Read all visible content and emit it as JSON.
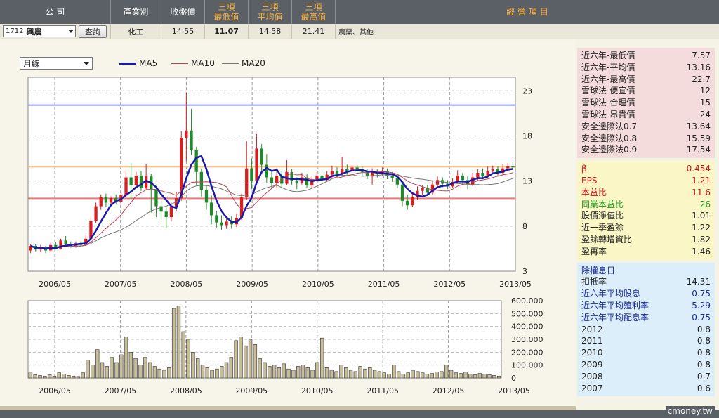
{
  "header": {
    "company": "公  司",
    "industry": "產業別",
    "close": "收盤價",
    "low_1": "三項",
    "low_2": "最低值",
    "avg_1": "三項",
    "avg_2": "平均值",
    "high_1": "三項",
    "high_2": "最高值",
    "business": "經 營 項 目"
  },
  "row": {
    "stock_code": "1712",
    "stock_name": "興農",
    "query_button": "查詢",
    "industry": "化工",
    "close": "14.55",
    "low": "11.07",
    "avg": "14.58",
    "high": "21.41",
    "business": "農藥、其他"
  },
  "chart_controls": {
    "period": "月線",
    "ma5": "MA5",
    "ma10": "MA10",
    "ma20": "MA20"
  },
  "colors": {
    "ma5": "#1a1aa8",
    "ma10": "#c04050",
    "ma20": "#777777",
    "up": "#d62020",
    "down": "#1f8a2a",
    "line_high": "#8a90ff",
    "line_avg": "#ffc080",
    "line_low": "#ff7070",
    "volume_bar": "#c7bd9a"
  },
  "chart_data": [
    {
      "type": "candlestick",
      "x_labels": [
        "2006/05",
        "2007/05",
        "2008/05",
        "2009/05",
        "2010/05",
        "2011/05",
        "2012/05",
        "2013/05"
      ],
      "y_ticks": [
        23,
        18,
        13,
        8,
        3
      ],
      "ylim": [
        3,
        24.5
      ],
      "reference_lines": {
        "high": 21.41,
        "avg": 14.58,
        "low": 11.07
      },
      "candles": [
        {
          "o": 5.3,
          "c": 5.8,
          "h": 6.0,
          "l": 5.0
        },
        {
          "o": 5.8,
          "c": 5.4,
          "h": 6.0,
          "l": 5.2
        },
        {
          "o": 5.4,
          "c": 5.6,
          "h": 5.9,
          "l": 5.1
        },
        {
          "o": 5.6,
          "c": 5.3,
          "h": 5.8,
          "l": 5.0
        },
        {
          "o": 5.3,
          "c": 5.9,
          "h": 6.1,
          "l": 5.2
        },
        {
          "o": 5.9,
          "c": 5.5,
          "h": 6.2,
          "l": 5.4
        },
        {
          "o": 5.5,
          "c": 6.4,
          "h": 6.6,
          "l": 5.4
        },
        {
          "o": 6.4,
          "c": 6.0,
          "h": 6.9,
          "l": 5.8
        },
        {
          "o": 6.0,
          "c": 5.8,
          "h": 6.3,
          "l": 5.6
        },
        {
          "o": 5.8,
          "c": 6.1,
          "h": 6.3,
          "l": 5.6
        },
        {
          "o": 6.1,
          "c": 5.9,
          "h": 6.3,
          "l": 5.7
        },
        {
          "o": 5.9,
          "c": 6.6,
          "h": 7.0,
          "l": 5.8
        },
        {
          "o": 6.6,
          "c": 8.6,
          "h": 8.9,
          "l": 6.5
        },
        {
          "o": 8.6,
          "c": 10.2,
          "h": 10.6,
          "l": 8.3
        },
        {
          "o": 10.2,
          "c": 11.2,
          "h": 11.5,
          "l": 9.8
        },
        {
          "o": 11.2,
          "c": 10.6,
          "h": 11.6,
          "l": 10.1
        },
        {
          "o": 10.6,
          "c": 11.1,
          "h": 11.3,
          "l": 10.3
        },
        {
          "o": 11.1,
          "c": 10.7,
          "h": 11.5,
          "l": 10.5
        },
        {
          "o": 10.7,
          "c": 11.4,
          "h": 11.7,
          "l": 10.5
        },
        {
          "o": 11.4,
          "c": 13.4,
          "h": 14.2,
          "l": 11.2
        },
        {
          "o": 13.4,
          "c": 12.5,
          "h": 15.0,
          "l": 11.0
        },
        {
          "o": 12.5,
          "c": 13.6,
          "h": 14.0,
          "l": 12.2
        },
        {
          "o": 13.6,
          "c": 12.2,
          "h": 14.1,
          "l": 11.9
        },
        {
          "o": 12.2,
          "c": 13.5,
          "h": 14.9,
          "l": 12.0
        },
        {
          "o": 13.5,
          "c": 12.1,
          "h": 13.8,
          "l": 9.5
        },
        {
          "o": 12.1,
          "c": 10.2,
          "h": 12.3,
          "l": 9.0
        },
        {
          "o": 10.2,
          "c": 9.6,
          "h": 10.8,
          "l": 8.7
        },
        {
          "o": 9.6,
          "c": 9.0,
          "h": 10.0,
          "l": 7.8
        },
        {
          "o": 9.0,
          "c": 10.1,
          "h": 10.6,
          "l": 8.5
        },
        {
          "o": 10.1,
          "c": 11.1,
          "h": 11.8,
          "l": 9.7
        },
        {
          "o": 11.1,
          "c": 17.8,
          "h": 18.5,
          "l": 10.8
        },
        {
          "o": 17.8,
          "c": 18.6,
          "h": 22.8,
          "l": 15.2
        },
        {
          "o": 18.6,
          "c": 16.4,
          "h": 21.0,
          "l": 15.9
        },
        {
          "o": 16.4,
          "c": 14.0,
          "h": 16.8,
          "l": 12.6
        },
        {
          "o": 14.0,
          "c": 12.0,
          "h": 14.4,
          "l": 11.3
        },
        {
          "o": 12.0,
          "c": 10.6,
          "h": 12.5,
          "l": 9.8
        },
        {
          "o": 10.6,
          "c": 9.2,
          "h": 11.4,
          "l": 8.2
        },
        {
          "o": 9.2,
          "c": 8.4,
          "h": 9.7,
          "l": 7.8
        },
        {
          "o": 8.4,
          "c": 8.1,
          "h": 9.2,
          "l": 7.6
        },
        {
          "o": 8.1,
          "c": 8.5,
          "h": 9.0,
          "l": 7.7
        },
        {
          "o": 8.5,
          "c": 8.2,
          "h": 9.1,
          "l": 7.7
        },
        {
          "o": 8.2,
          "c": 8.9,
          "h": 9.4,
          "l": 7.9
        },
        {
          "o": 8.9,
          "c": 11.2,
          "h": 11.6,
          "l": 8.7
        },
        {
          "o": 11.2,
          "c": 14.4,
          "h": 17.4,
          "l": 10.9
        },
        {
          "o": 14.4,
          "c": 13.0,
          "h": 15.5,
          "l": 12.1
        },
        {
          "o": 13.0,
          "c": 16.6,
          "h": 18.2,
          "l": 12.6
        },
        {
          "o": 16.6,
          "c": 14.8,
          "h": 17.1,
          "l": 13.8
        },
        {
          "o": 14.8,
          "c": 13.4,
          "h": 16.0,
          "l": 12.8
        },
        {
          "o": 13.4,
          "c": 12.8,
          "h": 14.0,
          "l": 12.3
        },
        {
          "o": 12.8,
          "c": 13.6,
          "h": 14.4,
          "l": 12.2
        },
        {
          "o": 13.6,
          "c": 12.7,
          "h": 14.1,
          "l": 12.3
        },
        {
          "o": 12.7,
          "c": 14.0,
          "h": 15.3,
          "l": 12.5
        },
        {
          "o": 14.0,
          "c": 13.0,
          "h": 14.3,
          "l": 12.6
        },
        {
          "o": 13.0,
          "c": 12.8,
          "h": 13.4,
          "l": 12.1
        },
        {
          "o": 12.8,
          "c": 13.4,
          "h": 13.9,
          "l": 12.6
        },
        {
          "o": 13.4,
          "c": 12.5,
          "h": 13.8,
          "l": 12.2
        },
        {
          "o": 12.5,
          "c": 13.2,
          "h": 13.6,
          "l": 12.2
        },
        {
          "o": 13.2,
          "c": 13.6,
          "h": 14.0,
          "l": 12.9
        },
        {
          "o": 13.6,
          "c": 13.1,
          "h": 14.0,
          "l": 12.8
        },
        {
          "o": 13.1,
          "c": 13.7,
          "h": 14.1,
          "l": 12.9
        },
        {
          "o": 13.7,
          "c": 14.1,
          "h": 14.7,
          "l": 13.5
        },
        {
          "o": 14.1,
          "c": 13.8,
          "h": 14.5,
          "l": 13.3
        },
        {
          "o": 13.8,
          "c": 14.3,
          "h": 15.7,
          "l": 13.6
        },
        {
          "o": 14.3,
          "c": 14.1,
          "h": 14.8,
          "l": 13.7
        },
        {
          "o": 14.1,
          "c": 14.5,
          "h": 14.9,
          "l": 13.9
        },
        {
          "o": 14.5,
          "c": 14.2,
          "h": 14.8,
          "l": 13.8
        },
        {
          "o": 14.2,
          "c": 14.0,
          "h": 14.6,
          "l": 13.6
        },
        {
          "o": 14.0,
          "c": 13.5,
          "h": 14.3,
          "l": 13.2
        },
        {
          "o": 13.5,
          "c": 14.0,
          "h": 14.4,
          "l": 12.6
        },
        {
          "o": 14.0,
          "c": 13.8,
          "h": 14.3,
          "l": 13.4
        },
        {
          "o": 13.8,
          "c": 14.1,
          "h": 14.5,
          "l": 13.6
        },
        {
          "o": 14.1,
          "c": 13.6,
          "h": 14.4,
          "l": 13.2
        },
        {
          "o": 13.6,
          "c": 13.3,
          "h": 14.0,
          "l": 12.9
        },
        {
          "o": 13.3,
          "c": 12.6,
          "h": 13.6,
          "l": 12.2
        },
        {
          "o": 12.6,
          "c": 10.8,
          "h": 12.9,
          "l": 10.2
        },
        {
          "o": 10.8,
          "c": 10.3,
          "h": 11.5,
          "l": 9.8
        },
        {
          "o": 10.3,
          "c": 11.2,
          "h": 11.7,
          "l": 10.1
        },
        {
          "o": 11.2,
          "c": 11.9,
          "h": 12.4,
          "l": 10.9
        },
        {
          "o": 11.9,
          "c": 12.2,
          "h": 12.5,
          "l": 11.5
        },
        {
          "o": 12.2,
          "c": 11.7,
          "h": 12.6,
          "l": 11.4
        },
        {
          "o": 11.7,
          "c": 12.6,
          "h": 13.0,
          "l": 11.5
        },
        {
          "o": 12.6,
          "c": 13.1,
          "h": 13.5,
          "l": 12.3
        },
        {
          "o": 13.1,
          "c": 12.7,
          "h": 13.4,
          "l": 12.3
        },
        {
          "o": 12.7,
          "c": 12.4,
          "h": 13.1,
          "l": 12.1
        },
        {
          "o": 12.4,
          "c": 12.9,
          "h": 13.3,
          "l": 12.2
        },
        {
          "o": 12.9,
          "c": 13.6,
          "h": 14.2,
          "l": 12.7
        },
        {
          "o": 13.6,
          "c": 13.1,
          "h": 13.9,
          "l": 12.6
        },
        {
          "o": 13.1,
          "c": 12.6,
          "h": 13.5,
          "l": 12.1
        },
        {
          "o": 12.6,
          "c": 13.4,
          "h": 13.9,
          "l": 12.4
        },
        {
          "o": 13.4,
          "c": 13.9,
          "h": 14.3,
          "l": 13.0
        },
        {
          "o": 13.9,
          "c": 13.5,
          "h": 14.4,
          "l": 13.2
        },
        {
          "o": 13.5,
          "c": 14.1,
          "h": 14.6,
          "l": 13.3
        },
        {
          "o": 14.1,
          "c": 14.3,
          "h": 14.7,
          "l": 13.8
        },
        {
          "o": 14.3,
          "c": 13.9,
          "h": 14.6,
          "l": 13.6
        },
        {
          "o": 13.9,
          "c": 14.4,
          "h": 14.9,
          "l": 13.7
        },
        {
          "o": 14.4,
          "c": 14.6,
          "h": 15.0,
          "l": 14.1
        },
        {
          "o": 14.6,
          "c": 14.5,
          "h": 15.1,
          "l": 14.2
        }
      ]
    },
    {
      "type": "bar",
      "x_labels": [
        "2006/05",
        "2007/05",
        "2008/05",
        "2009/05",
        "2010/05",
        "2011/05",
        "2012/05",
        "2013/05"
      ],
      "y_ticks": [
        "600,000",
        "500,000",
        "400,000",
        "300,000",
        "200,000",
        "100,000",
        "0"
      ],
      "ylim": [
        0,
        600000
      ],
      "values": [
        45000,
        25000,
        20000,
        15000,
        25000,
        15000,
        40000,
        30000,
        20000,
        15000,
        12000,
        40000,
        140000,
        100000,
        220000,
        120000,
        90000,
        160000,
        120000,
        180000,
        320000,
        200000,
        150000,
        100000,
        160000,
        120000,
        90000,
        70000,
        60000,
        80000,
        540000,
        560000,
        360000,
        300000,
        200000,
        150000,
        100000,
        80000,
        60000,
        70000,
        90000,
        120000,
        160000,
        290000,
        320000,
        250000,
        300000,
        260000,
        150000,
        120000,
        90000,
        100000,
        80000,
        110000,
        70000,
        60000,
        90000,
        100000,
        80000,
        60000,
        120000,
        310000,
        80000,
        60000,
        50000,
        100000,
        80000,
        60000,
        50000,
        90000,
        70000,
        80000,
        60000,
        50000,
        40000,
        30000,
        100000,
        50000,
        30000,
        40000,
        60000,
        50000,
        40000,
        30000,
        35000,
        45000,
        50000,
        100000,
        60000,
        40000,
        35000,
        45000,
        30000,
        25000,
        35000,
        30000,
        25000,
        20000,
        15000
      ]
    }
  ],
  "panel": {
    "pink": [
      {
        "k": "近六年-最低價",
        "v": "7.57"
      },
      {
        "k": "近六年-平均價",
        "v": "13.16"
      },
      {
        "k": "近六年-最高價",
        "v": "22.7"
      },
      {
        "k": "雪球法-便宜價",
        "v": "12"
      },
      {
        "k": "雪球法-合理價",
        "v": "15"
      },
      {
        "k": "雪球法-昂貴價",
        "v": "24"
      },
      {
        "k": "安全邊際法0.7",
        "v": "13.64"
      },
      {
        "k": "安全邊際法0.8",
        "v": "15.59"
      },
      {
        "k": "安全邊際法0.9",
        "v": "17.54"
      }
    ],
    "yellow": [
      {
        "k": "β",
        "v": "0.454",
        "cls": "red"
      },
      {
        "k": " EPS",
        "v": "1.21",
        "cls": "red"
      },
      {
        "k": "本益比",
        "v": "11.6",
        "cls": "red"
      },
      {
        "k": "同業本益比",
        "v": "26",
        "cls": "green"
      },
      {
        "k": "股價淨值比",
        "v": "1.01",
        "cls": ""
      },
      {
        "k": "近一季盈餘",
        "v": "1.22",
        "cls": ""
      },
      {
        "k": "盈餘轉增資比",
        "v": "1.82",
        "cls": ""
      },
      {
        "k": "盈再率",
        "v": "1.46",
        "cls": ""
      }
    ],
    "blue": [
      {
        "k": "除權息日",
        "v": "",
        "cls": "navy"
      },
      {
        "k": "扣抵率",
        "v": "14.31",
        "cls": ""
      },
      {
        "k": "近六年平均股息",
        "v": "0.75",
        "cls": "navy"
      },
      {
        "k": "近六年平均殖利率",
        "v": "5.29",
        "cls": "navy"
      },
      {
        "k": "近六年平均配息率",
        "v": "0.75",
        "cls": "navy"
      },
      {
        "k": "2012",
        "v": "0.8",
        "cls": ""
      },
      {
        "k": "2011",
        "v": "0.8",
        "cls": ""
      },
      {
        "k": "2010",
        "v": "0.8",
        "cls": ""
      },
      {
        "k": "2009",
        "v": "0.8",
        "cls": ""
      },
      {
        "k": "2008",
        "v": "0.7",
        "cls": ""
      },
      {
        "k": "2007",
        "v": "0.6",
        "cls": ""
      }
    ]
  },
  "brand": "cmoney.tw"
}
